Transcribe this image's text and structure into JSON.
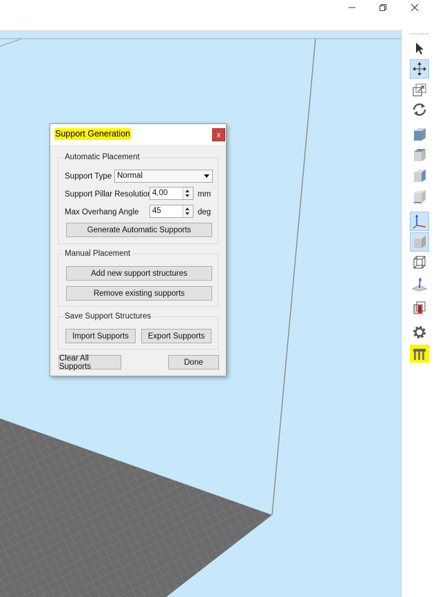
{
  "window": {
    "controls": {
      "minimize_icon": "minimize-icon",
      "restore_icon": "restore-icon",
      "close_icon": "close-icon"
    }
  },
  "colors": {
    "viewport_bg": "#c7e8fa",
    "platform_grid": "#6e6e6e",
    "highlight": "#fff500",
    "close_button": "#c84340",
    "active_tool": "#cde4f7"
  },
  "dialog": {
    "title": "Support Generation",
    "close_label": "x",
    "automatic": {
      "group_label": "Automatic Placement",
      "support_type_label": "Support Type",
      "support_type_value": "Normal",
      "pillar_resolution_label": "Support Pillar Resolution",
      "pillar_resolution_value": "4,00",
      "pillar_resolution_unit": "mm",
      "overhang_label": "Max Overhang Angle",
      "overhang_value": "45",
      "overhang_unit": "deg",
      "generate_button": "Generate Automatic Supports"
    },
    "manual": {
      "group_label": "Manual Placement",
      "add_button": "Add new support structures",
      "remove_button": "Remove existing supports"
    },
    "save": {
      "group_label": "Save Support Structures",
      "import_button": "Import Supports",
      "export_button": "Export Supports"
    },
    "clear_button": "Clear All Supports",
    "done_button": "Done"
  },
  "toolbar": {
    "items": [
      {
        "icon": "select-arrow-icon",
        "active": false
      },
      {
        "icon": "move-icon",
        "active": true
      },
      {
        "icon": "scale-icon",
        "active": false
      },
      {
        "icon": "rotate-icon",
        "active": false
      },
      {
        "icon": "view-front-cube-icon",
        "active": false
      },
      {
        "icon": "view-top-cube-icon",
        "active": false
      },
      {
        "icon": "view-side-cube-icon",
        "active": false
      },
      {
        "icon": "view-bottom-cube-icon",
        "active": false
      },
      {
        "icon": "axes-icon",
        "active": true
      },
      {
        "icon": "solid-cube-icon",
        "active": true
      },
      {
        "icon": "wireframe-cube-icon",
        "active": false
      },
      {
        "icon": "normals-icon",
        "active": false
      },
      {
        "icon": "section-cube-icon",
        "active": false
      },
      {
        "icon": "settings-gear-icon",
        "active": false
      },
      {
        "icon": "support-generation-icon",
        "active": false,
        "highlighted": true
      }
    ]
  }
}
